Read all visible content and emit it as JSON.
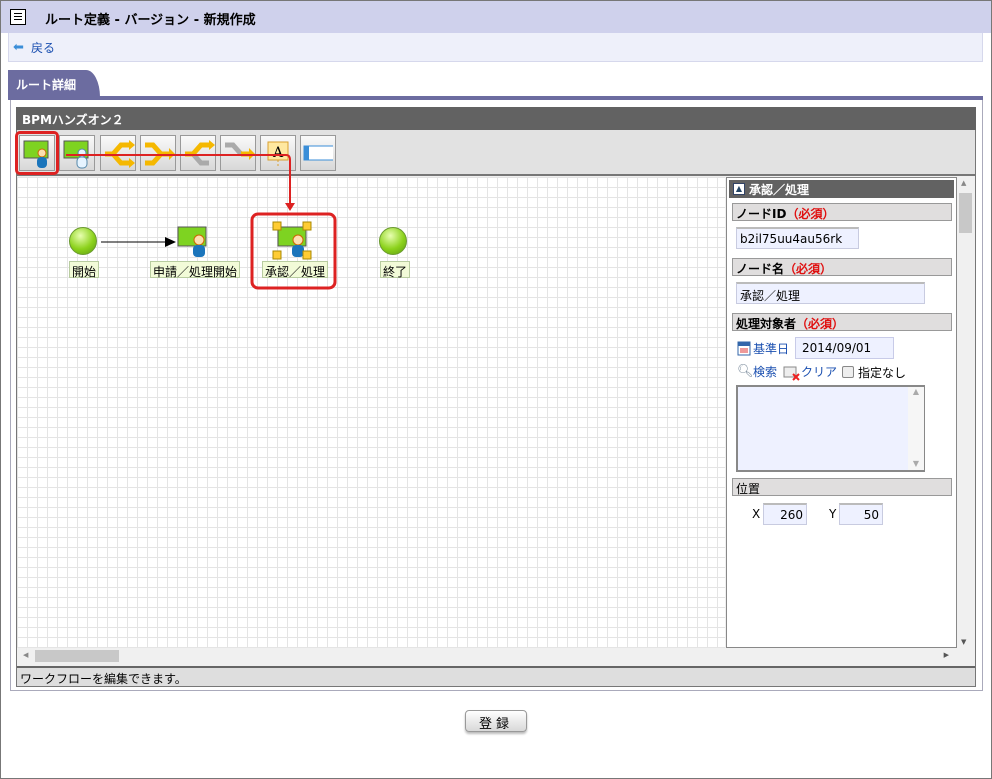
{
  "header": {
    "title": "ルート定義 - バージョン - 新規作成",
    "back_label": "戻る"
  },
  "tab": {
    "label": "ルート詳細"
  },
  "editor": {
    "title": "BPMハンズオン２",
    "toolbar": [
      "user-task-node",
      "system-task-node",
      "split-node",
      "join-node",
      "branch-node",
      "merge-node",
      "text-annotation",
      "panel"
    ],
    "nodes": [
      {
        "label": "開始",
        "type": "start"
      },
      {
        "label": "申請／処理開始",
        "type": "user-task"
      },
      {
        "label": "承認／処理",
        "type": "user-task",
        "selected": true
      },
      {
        "label": "終了",
        "type": "end"
      }
    ],
    "status": "ワークフローを編集できます。"
  },
  "properties": {
    "title": "承認／処理",
    "node_id_label": "ノードID",
    "required": "（必須）",
    "node_id": "b2il75uu4au56rk",
    "node_name_label": "ノード名",
    "node_name": "承認／処理",
    "assignee_label": "処理対象者",
    "base_date_label": "基準日",
    "base_date": "2014/09/01",
    "search_label": "検索",
    "clear_label": "クリア",
    "unspecified_label": "指定なし",
    "position_label": "位置",
    "x_label": "X",
    "x": "260",
    "y_label": "Y",
    "y": "50"
  },
  "register_label": "登録",
  "colors": {
    "accent": "#6c6ca0",
    "highlight": "#d22222",
    "required": "#e01010"
  }
}
